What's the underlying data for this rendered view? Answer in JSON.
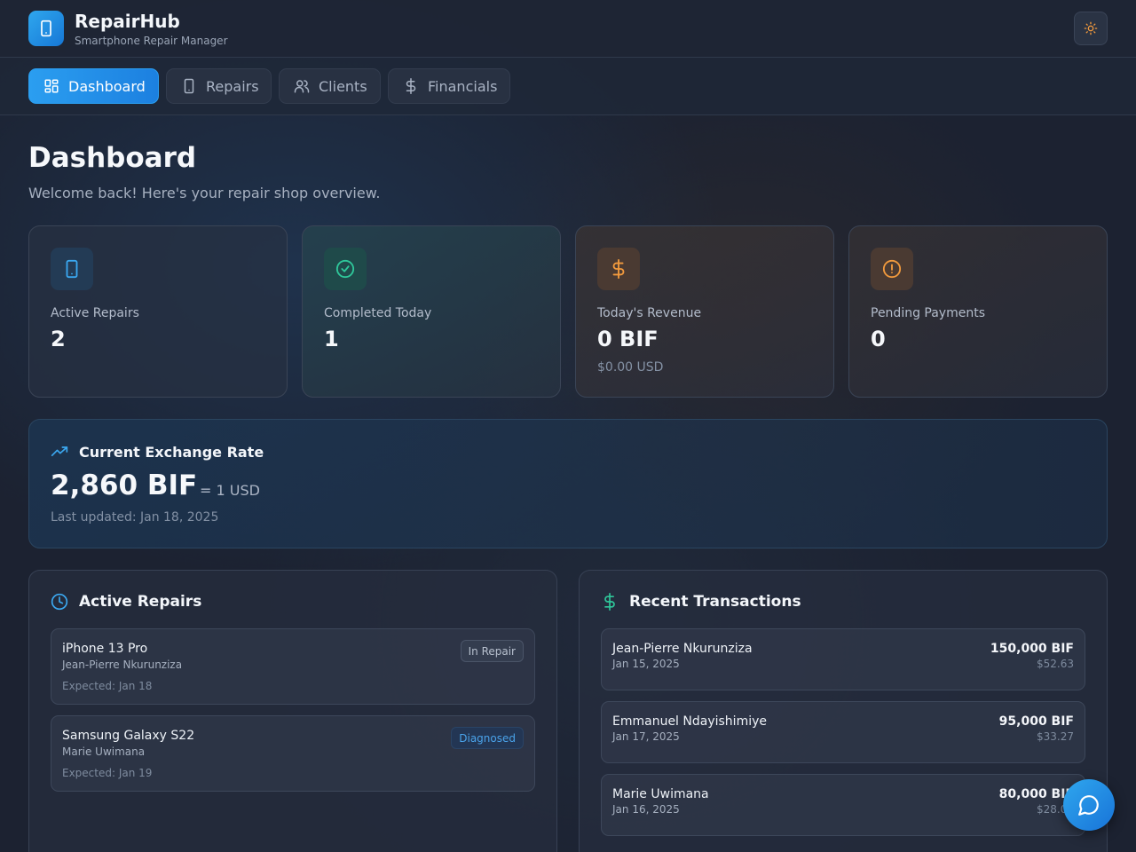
{
  "app": {
    "title": "RepairHub",
    "subtitle": "Smartphone Repair Manager",
    "logo_icon": "smartphone-icon",
    "theme_icon": "sun-icon"
  },
  "nav": {
    "tabs": [
      {
        "label": "Dashboard",
        "icon": "dashboard-icon",
        "active": true
      },
      {
        "label": "Repairs",
        "icon": "smartphone-icon",
        "active": false
      },
      {
        "label": "Clients",
        "icon": "users-icon",
        "active": false
      },
      {
        "label": "Financials",
        "icon": "dollar-icon",
        "active": false
      }
    ]
  },
  "page": {
    "title": "Dashboard",
    "subtitle": "Welcome back! Here's your repair shop overview."
  },
  "stats": [
    {
      "label": "Active Repairs",
      "value": "2",
      "sub": "",
      "icon": "smartphone-icon",
      "color": "#3ba8f0"
    },
    {
      "label": "Completed Today",
      "value": "1",
      "sub": "",
      "icon": "check-circle-icon",
      "color": "#2fc79a"
    },
    {
      "label": "Today's Revenue",
      "value": "0 BIF",
      "sub": "$0.00 USD",
      "icon": "dollar-icon",
      "color": "#f29a3d"
    },
    {
      "label": "Pending Payments",
      "value": "0",
      "sub": "",
      "icon": "alert-circle-icon",
      "color": "#f29a3d"
    }
  ],
  "exchange": {
    "title": "Current Exchange Rate",
    "rate": "2,860 BIF",
    "equals": "= 1 USD",
    "updated": "Last updated: Jan 18, 2025",
    "icon": "trending-up-icon"
  },
  "active_repairs": {
    "title": "Active Repairs",
    "icon": "clock-icon",
    "items": [
      {
        "device": "iPhone 13 Pro",
        "client": "Jean-Pierre Nkurunziza",
        "expected": "Expected: Jan 18",
        "status": "In Repair"
      },
      {
        "device": "Samsung Galaxy S22",
        "client": "Marie Uwimana",
        "expected": "Expected: Jan 19",
        "status": "Diagnosed"
      }
    ]
  },
  "transactions": {
    "title": "Recent Transactions",
    "icon": "dollar-icon",
    "items": [
      {
        "name": "Jean-Pierre Nkurunziza",
        "date": "Jan 15, 2025",
        "amount": "150,000 BIF",
        "usd": "$52.63"
      },
      {
        "name": "Emmanuel Ndayishimiye",
        "date": "Jan 17, 2025",
        "amount": "95,000 BIF",
        "usd": "$33.27"
      },
      {
        "name": "Marie Uwimana",
        "date": "Jan 16, 2025",
        "amount": "80,000 BIF",
        "usd": "$28.00"
      }
    ]
  },
  "chat": {
    "icon": "chat-bubble-icon"
  },
  "colors": {
    "accent": "#2b9ef0",
    "success": "#2fc79a",
    "warning": "#f29a3d"
  }
}
